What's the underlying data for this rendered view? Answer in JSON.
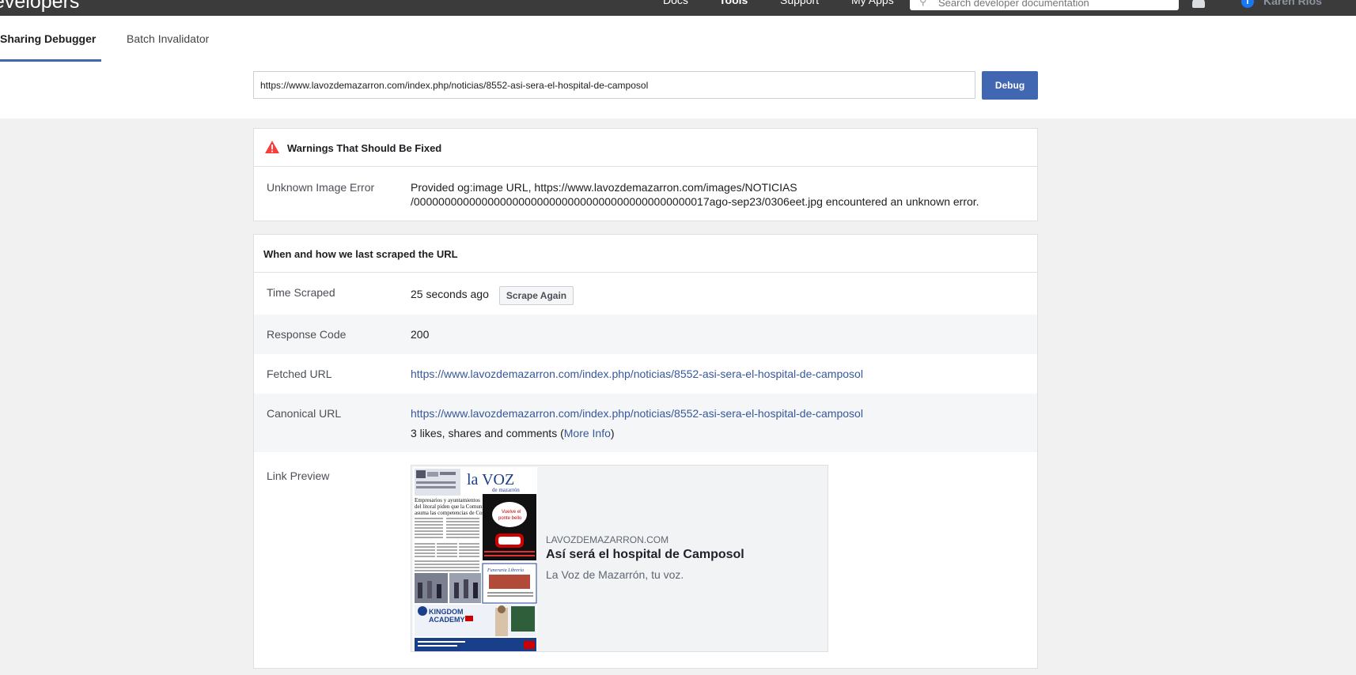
{
  "topbar": {
    "brand": "evelopers",
    "nav": [
      "Docs",
      "Tools",
      "Support",
      "My Apps"
    ],
    "search_placeholder": "Search developer documentation",
    "user_name": "Karen Ríos"
  },
  "tabs": [
    "Sharing Debugger",
    "Batch Invalidator"
  ],
  "url_input_value": "https://www.lavozdemazarron.com/index.php/noticias/8552-asi-sera-el-hospital-de-camposol",
  "debug_label": "Debug",
  "warnings": {
    "title": "Warnings That Should Be Fixed",
    "label": "Unknown Image Error",
    "line1": "Provided og:image URL, https://www.lavozdemazarron.com/images/NOTICIAS",
    "line2": "/000000000000000000000000000000000000000000000017ago-sep23/0306eet.jpg encountered an unknown error."
  },
  "scrape": {
    "title": "When and how we last scraped the URL",
    "time_label": "Time Scraped",
    "time_value": "25 seconds ago",
    "scrape_again": "Scrape Again",
    "response_label": "Response Code",
    "response_value": "200",
    "fetched_label": "Fetched URL",
    "fetched_value": "https://www.lavozdemazarron.com/index.php/noticias/8552-asi-sera-el-hospital-de-camposol",
    "canonical_label": "Canonical URL",
    "canonical_value": "https://www.lavozdemazarron.com/index.php/noticias/8552-asi-sera-el-hospital-de-camposol",
    "engagement_prefix": "3 likes, shares and comments (",
    "more_info": "More Info",
    "engagement_suffix": ")",
    "preview_label": "Link Preview"
  },
  "preview": {
    "domain": "LAVOZDEMAZARRON.COM",
    "title": "Así será el hospital de Camposol",
    "description": "La Voz de Mazarrón, tu voz.",
    "thumb_logo": "la VOZ",
    "thumb_sub": "de mazarrón",
    "thumb_headline": "Empresarios y ayuntamientos del litoral piden que la Comunidad asuma las competencias de Costas",
    "thumb_academy": "KINGDOM ACADEMY"
  },
  "colors": {
    "accent": "#4267b2",
    "link": "#365899",
    "warning": "#fa3e3e"
  }
}
